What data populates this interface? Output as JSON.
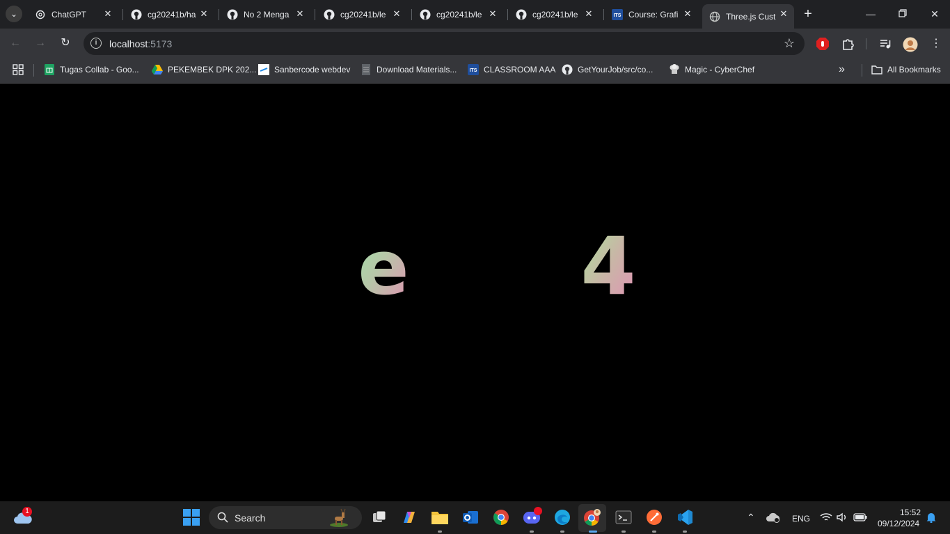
{
  "tabs": [
    {
      "label": "ChatGPT",
      "icon": "chatgpt-icon"
    },
    {
      "label": "cg20241b/ha",
      "icon": "github-icon"
    },
    {
      "label": "No 2 Menga",
      "icon": "github-icon"
    },
    {
      "label": "cg20241b/le",
      "icon": "github-icon"
    },
    {
      "label": "cg20241b/le",
      "icon": "github-icon"
    },
    {
      "label": "cg20241b/le",
      "icon": "github-icon"
    },
    {
      "label": "Course: Grafi",
      "icon": "its-icon"
    },
    {
      "label": "Three.js Cust",
      "icon": "globe-icon",
      "active": true
    }
  ],
  "address": {
    "host": "localhost",
    "port": ":5173"
  },
  "bookmarks": [
    {
      "label": "Tugas Collab - Goo...",
      "icon": "sheets-icon"
    },
    {
      "label": "PEKEMBEK DPK 202...",
      "icon": "drive-icon"
    },
    {
      "label": "Sanbercode webdev",
      "icon": "sanbercode-icon"
    },
    {
      "label": "Download Materials...",
      "icon": "doc-icon"
    },
    {
      "label": "CLASSROOM AAA",
      "icon": "its-icon"
    },
    {
      "label": "GetYourJob/src/co...",
      "icon": "github-icon"
    },
    {
      "label": "Magic - CyberChef",
      "icon": "chef-icon"
    }
  ],
  "all_bookmarks_label": "All Bookmarks",
  "scene": {
    "left_glyph": "e",
    "right_glyph": "4"
  },
  "taskbar": {
    "search_placeholder": "Search",
    "weather_badge": "1",
    "language": "ENG",
    "time": "15:52",
    "date": "09/12/2024"
  },
  "colors": {
    "tab_bar": "#202124",
    "toolbar": "#35363a",
    "taskbar": "#1c1c1c"
  }
}
